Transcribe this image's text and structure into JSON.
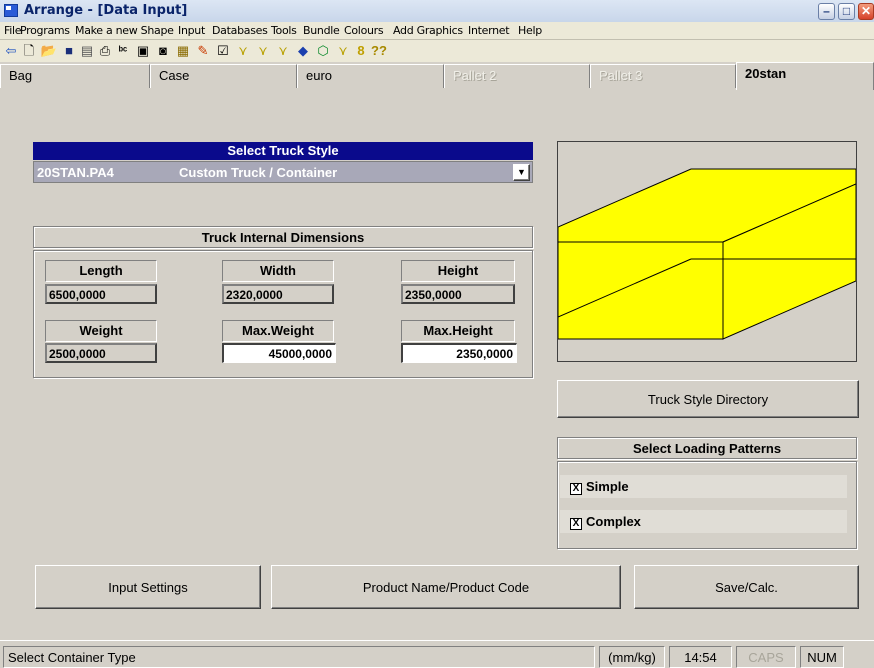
{
  "window": {
    "title": "Arrange - [Data Input]"
  },
  "menu": [
    "File",
    "Programs",
    "Make a new Shape",
    "Input",
    "Databases",
    "Tools",
    "Bundle",
    "Colours",
    "Add Graphics",
    "Internet",
    "Help"
  ],
  "toolbar_icons": [
    "back-icon",
    "new-icon",
    "open-icon",
    "save-icon",
    "calculator-icon",
    "print-icon",
    "spell-icon",
    "document-icon",
    "camera-icon",
    "pallets-icon",
    "graphics-icon",
    "properties-icon",
    "truck-load-icon",
    "truck-unload-icon",
    "truck-settings-icon",
    "book-icon",
    "box-icon",
    "wizard-icon",
    "number8-icon",
    "help-icon"
  ],
  "tabs": [
    {
      "label": "Bag",
      "state": "normal"
    },
    {
      "label": "Case",
      "state": "normal"
    },
    {
      "label": "euro",
      "state": "normal"
    },
    {
      "label": "Pallet 2",
      "state": "disabled"
    },
    {
      "label": "Pallet 3",
      "state": "disabled"
    },
    {
      "label": "20stan",
      "state": "active"
    }
  ],
  "truck_style": {
    "header": "Select Truck Style",
    "selected_code": "20STAN.PA4",
    "selected_name": "Custom Truck / Container"
  },
  "dimensions": {
    "header": "Truck Internal Dimensions",
    "length": {
      "label": "Length",
      "value": "6500,0000"
    },
    "width": {
      "label": "Width",
      "value": "2320,0000"
    },
    "height": {
      "label": "Height",
      "value": "2350,0000"
    },
    "weight": {
      "label": "Weight",
      "value": "2500,0000"
    },
    "max_weight": {
      "label": "Max.Weight",
      "value": "45000,0000"
    },
    "max_height": {
      "label": "Max.Height",
      "value": "2350,0000"
    }
  },
  "preview": {
    "fill": "#ffff00"
  },
  "truck_style_directory_label": "Truck Style Directory",
  "loading_patterns": {
    "header": "Select Loading Patterns",
    "simple": {
      "label": "Simple",
      "checked": true,
      "mark": "X"
    },
    "complex": {
      "label": "Complex",
      "checked": true,
      "mark": "X"
    }
  },
  "buttons": {
    "input_settings": "Input Settings",
    "product_name": "Product Name/Product Code",
    "save_calc": "Save/Calc."
  },
  "status": {
    "message": "Select Container Type",
    "units": "(mm/kg)",
    "time": "14:54",
    "caps": "CAPS",
    "num": "NUM"
  }
}
